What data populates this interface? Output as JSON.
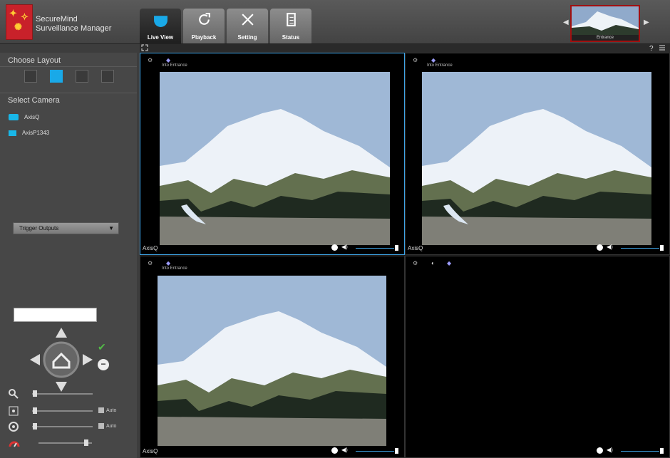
{
  "app": {
    "title": "SecureMind",
    "subtitle": "Surveillance Manager"
  },
  "tabs": [
    {
      "label": "Live View",
      "active": true,
      "icon": "camera-dome-icon"
    },
    {
      "label": "Playback",
      "active": false,
      "icon": "refresh-icon"
    },
    {
      "label": "Setting",
      "active": false,
      "icon": "tools-icon"
    },
    {
      "label": "Status",
      "active": false,
      "icon": "document-icon"
    }
  ],
  "preview": {
    "caption": "Entrance"
  },
  "sidebar": {
    "choose_layout": "Choose Layout",
    "select_camera": "Select Camera",
    "cameras": [
      {
        "name": "AxisQ",
        "icon": "dome-camera-icon"
      },
      {
        "name": "AxisP1343",
        "icon": "box-camera-icon"
      }
    ],
    "dropdown": "Trigger Outputs",
    "auto1": "Auto",
    "auto2": "Auto"
  },
  "panes": [
    {
      "name": "AxisQ",
      "title": "Into Entrance",
      "selected": true
    },
    {
      "name": "AxisQ",
      "title": "Into Entrance",
      "selected": false
    },
    {
      "name": "AxisQ",
      "title": "Into Entrance",
      "selected": false
    },
    {
      "name": "",
      "title": "",
      "selected": false
    }
  ],
  "colors": {
    "accent": "#3ea4e6",
    "logo": "#c8212a",
    "check": "#52b947"
  },
  "controls": {
    "focus": "Focus",
    "iris": "Iris",
    "zoom": "Zoom"
  }
}
